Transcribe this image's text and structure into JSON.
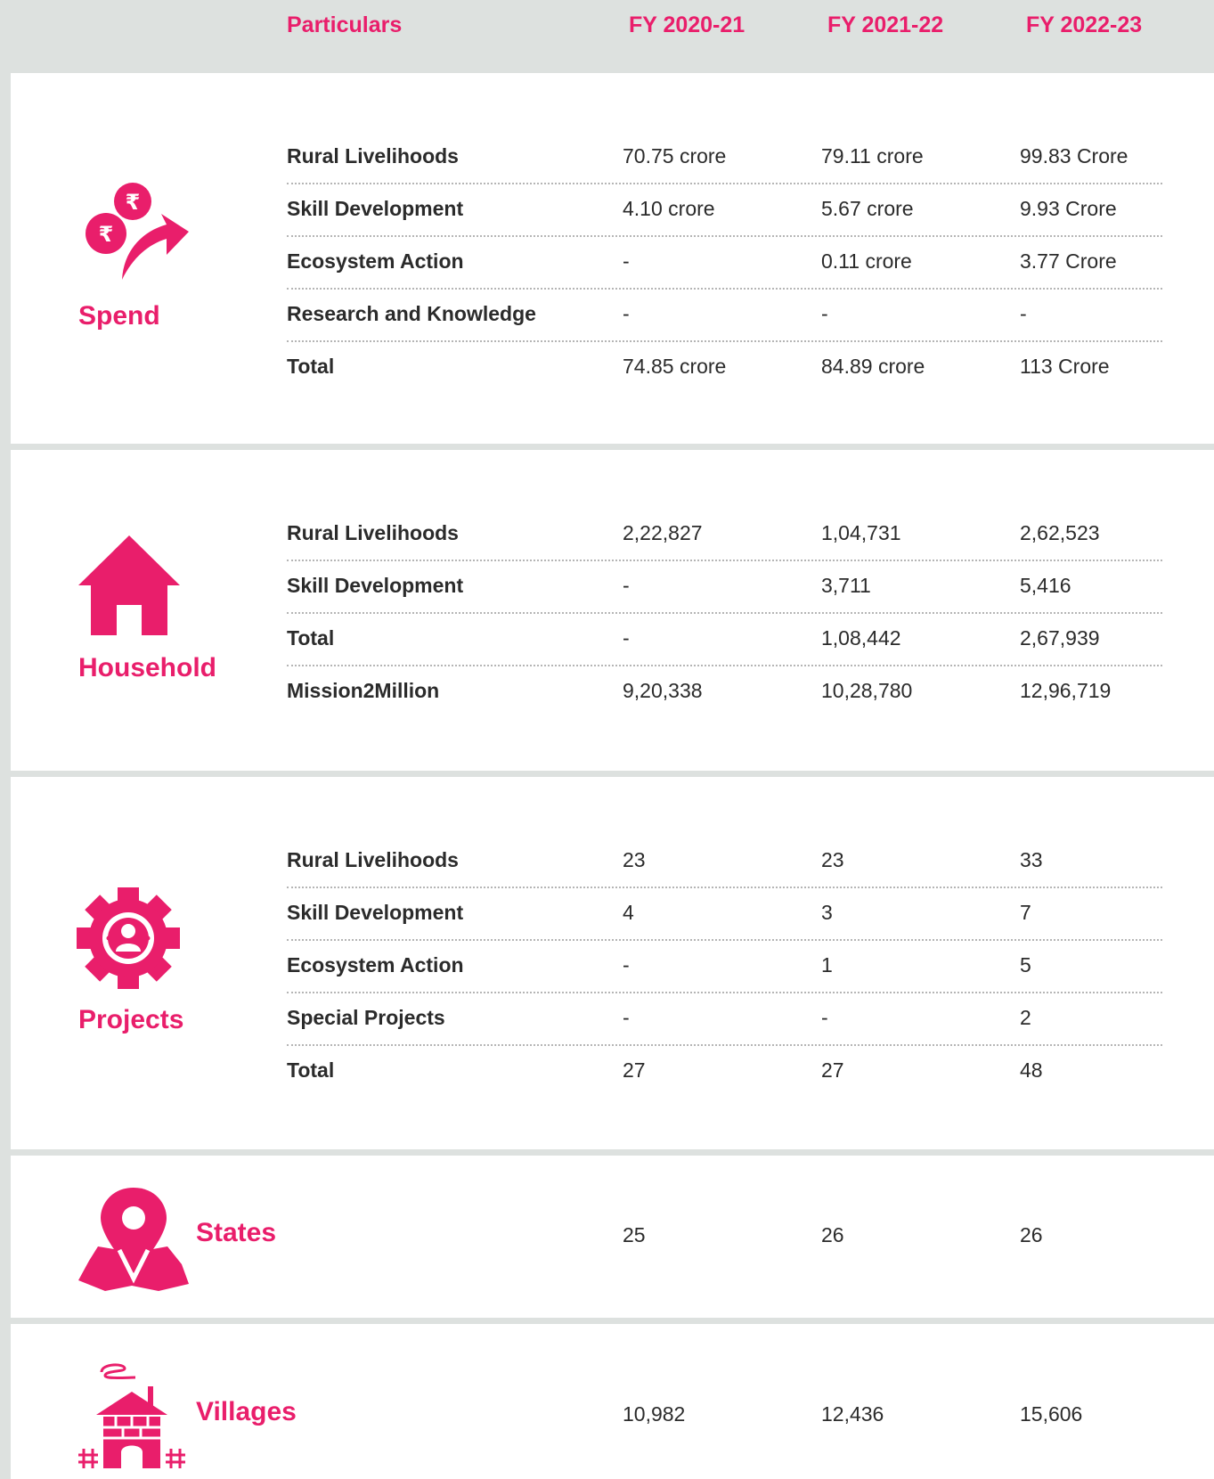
{
  "header": {
    "particulars": "Particulars",
    "fy1": "FY 2020-21",
    "fy2": "FY 2021-22",
    "fy3": "FY 2022-23"
  },
  "colors": {
    "accent": "#e91e6b",
    "background": "#dde1df",
    "panel": "#ffffff"
  },
  "spend": {
    "title": "Spend",
    "icon": "rupee-coins-arrow-icon",
    "rows": [
      {
        "label": "Rural Livelihoods",
        "v1": "70.75 crore",
        "v2": "79.11 crore",
        "v3": "99.83 Crore"
      },
      {
        "label": "Skill Development",
        "v1": "4.10 crore",
        "v2": "5.67 crore",
        "v3": "9.93 Crore"
      },
      {
        "label": "Ecosystem Action",
        "v1": "-",
        "v2": "0.11 crore",
        "v3": "3.77 Crore"
      },
      {
        "label": "Research and Knowledge",
        "v1": "-",
        "v2": "-",
        "v3": "-"
      },
      {
        "label": "Total",
        "v1": "74.85 crore",
        "v2": "84.89 crore",
        "v3": "113 Crore"
      }
    ]
  },
  "household": {
    "title": "Household",
    "icon": "house-icon",
    "rows": [
      {
        "label": "Rural Livelihoods",
        "v1": "2,22,827",
        "v2": "1,04,731",
        "v3": "2,62,523"
      },
      {
        "label": "Skill Development",
        "v1": "-",
        "v2": "3,711",
        "v3": "5,416"
      },
      {
        "label": "Total",
        "v1": "-",
        "v2": "1,08,442",
        "v3": "2,67,939"
      },
      {
        "label": "Mission2Million",
        "v1": "9,20,338",
        "v2": "10,28,780",
        "v3": "12,96,719"
      }
    ]
  },
  "projects": {
    "title": "Projects",
    "icon": "gear-person-icon",
    "rows": [
      {
        "label": "Rural Livelihoods",
        "v1": "23",
        "v2": "23",
        "v3": "33"
      },
      {
        "label": "Skill Development",
        "v1": "4",
        "v2": "3",
        "v3": "7"
      },
      {
        "label": "Ecosystem Action",
        "v1": "-",
        "v2": "1",
        "v3": "5"
      },
      {
        "label": "Special Projects",
        "v1": "-",
        "v2": "-",
        "v3": "2"
      },
      {
        "label": "Total",
        "v1": "27",
        "v2": "27",
        "v3": "48"
      }
    ]
  },
  "states": {
    "title": "States",
    "icon": "map-pin-icon",
    "v1": "25",
    "v2": "26",
    "v3": "26"
  },
  "villages": {
    "title": "Villages",
    "icon": "village-hut-icon",
    "v1": "10,982",
    "v2": "12,436",
    "v3": "15,606"
  }
}
